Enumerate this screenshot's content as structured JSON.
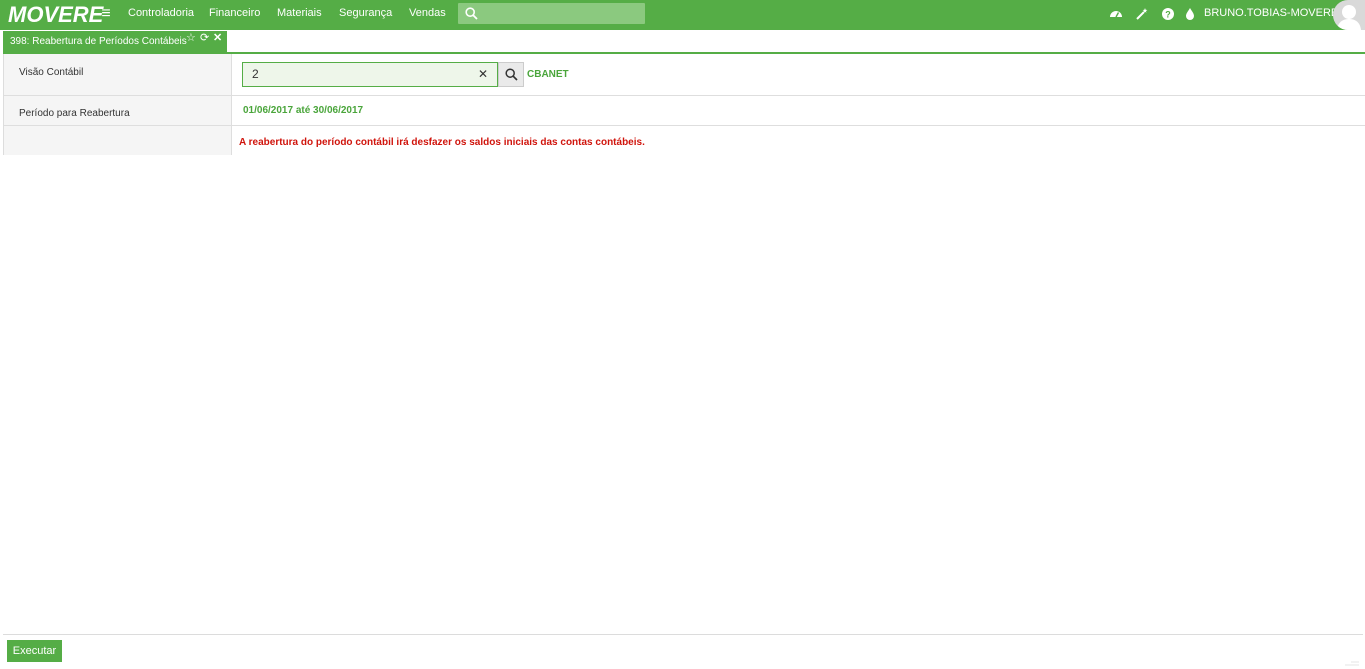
{
  "header": {
    "logo_text": "MOVERE",
    "nav": [
      "Controladoria",
      "Financeiro",
      "Materiais",
      "Segurança",
      "Vendas"
    ],
    "search_placeholder": "",
    "icons": [
      "dashboard-icon",
      "magic-wand-icon",
      "help-icon",
      "drop-icon"
    ],
    "username": "BRUNO.TOBIAS-MOVERE",
    "accent": "#55ad46"
  },
  "tab": {
    "title": "398: Reabertura de Períodos Contábeis",
    "icons": [
      "star-icon",
      "refresh-icon",
      "close-icon"
    ]
  },
  "form": {
    "visao": {
      "label": "Visão Contábil",
      "value": "2",
      "description": "CBANET"
    },
    "periodo": {
      "label": "Período para Reabertura",
      "value": "01/06/2017 até 30/06/2017"
    },
    "warning": "A reabertura do período contábil irá desfazer os saldos iniciais das contas contábeis."
  },
  "footer": {
    "execute_label": "Executar"
  },
  "colors": {
    "brand": "#55ad46",
    "warning": "#d0140c",
    "value_green": "#4aa53b"
  }
}
